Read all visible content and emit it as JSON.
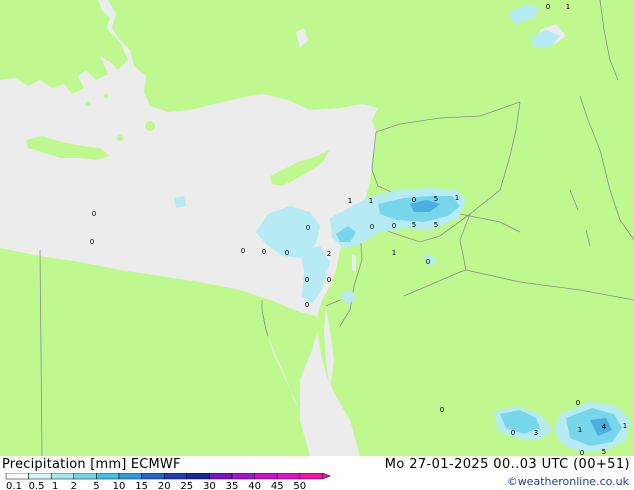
{
  "title": {
    "product": "Precipitation [mm]",
    "model": "ECMWF"
  },
  "datetime": "Mo 27-01-2025 00..03 UTC (00+51)",
  "credit": "©weatheronline.co.uk",
  "colors": {
    "sea": "#ececec",
    "land": "#c0f890",
    "border": "#8c8c8c",
    "precip_light": "#b6ebf3",
    "precip_mid": "#78d6ea",
    "precip_strong": "#4aaede"
  },
  "legend": {
    "ticks": [
      "0.1",
      "0.5",
      "1",
      "2",
      "5",
      "10",
      "15",
      "20",
      "25",
      "30",
      "35",
      "40",
      "45",
      "50"
    ],
    "colors": [
      "#fbfbfb",
      "#d2f2f6",
      "#a6e6f0",
      "#74d4e8",
      "#46c0e0",
      "#2f9bd9",
      "#2366c8",
      "#1a3fb4",
      "#162a9a",
      "#7c14c4",
      "#a414d8",
      "#c814d2",
      "#e014c6",
      "#f014b0"
    ]
  },
  "map_values": [
    {
      "id": "cyprus-n",
      "text": "0"
    },
    {
      "id": "turkey-se",
      "text": "1"
    },
    {
      "id": "med-w1",
      "text": "0"
    },
    {
      "id": "med-w2",
      "text": "0"
    },
    {
      "id": "lebanon-1",
      "text": "1"
    },
    {
      "id": "lebanon-2",
      "text": "1"
    },
    {
      "id": "syria-1",
      "text": "0"
    },
    {
      "id": "syria-2",
      "text": "5"
    },
    {
      "id": "syria-3",
      "text": "1"
    },
    {
      "id": "med-e",
      "text": "0"
    },
    {
      "id": "syria-4",
      "text": "0"
    },
    {
      "id": "syria-5",
      "text": "0"
    },
    {
      "id": "syria-6",
      "text": "5"
    },
    {
      "id": "syria-7",
      "text": "5"
    },
    {
      "id": "med-s1",
      "text": "0"
    },
    {
      "id": "med-s2",
      "text": "0"
    },
    {
      "id": "med-s3",
      "text": "0"
    },
    {
      "id": "israel-1",
      "text": "2"
    },
    {
      "id": "jordan-1",
      "text": "1"
    },
    {
      "id": "jordan-2",
      "text": "0"
    },
    {
      "id": "sinai-1",
      "text": "0"
    },
    {
      "id": "negev-1",
      "text": "0"
    },
    {
      "id": "sinai-2",
      "text": "0"
    },
    {
      "id": "saudi-1",
      "text": "0"
    },
    {
      "id": "saudi-2",
      "text": "0"
    },
    {
      "id": "saudi-3",
      "text": "0"
    },
    {
      "id": "saudi-4",
      "text": "3"
    },
    {
      "id": "saudi-5",
      "text": "1"
    },
    {
      "id": "saudi-6",
      "text": "4"
    },
    {
      "id": "saudi-7",
      "text": "1"
    },
    {
      "id": "saudi-8",
      "text": "5"
    },
    {
      "id": "saudi-9",
      "text": "0"
    }
  ]
}
